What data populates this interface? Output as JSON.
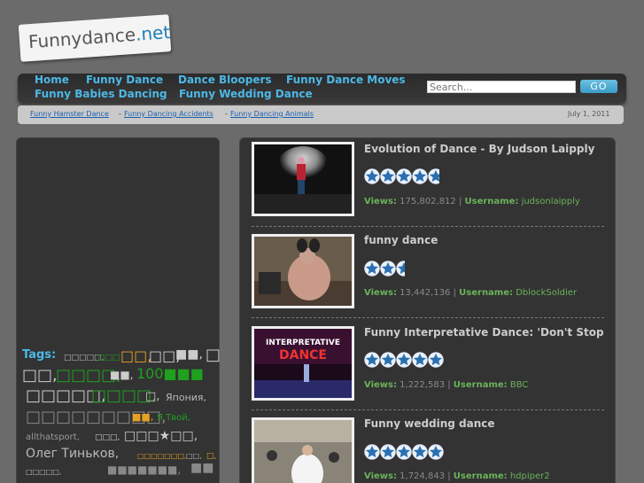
{
  "logo": {
    "name": "Funnydance",
    "tld": ".net"
  },
  "nav": {
    "row1": [
      "Home",
      "Funny Dance",
      "Dance Bloopers",
      "Funny Dance Moves"
    ],
    "row2": [
      "Funny Babies Dancing",
      "Funny Wedding Dance"
    ]
  },
  "search": {
    "placeholder": "Search...",
    "go_label": "GO"
  },
  "breadcrumbs": [
    "Funny Hamster Dance",
    "Funny Dancing Accidents",
    "Funny Dancing Animals"
  ],
  "date": "July 1, 2011",
  "sidebar": {
    "tags_label": "Tags:",
    "tags": [
      "□□□□□,",
      "□□□",
      "□□,",
      "□□,",
      "■■,",
      "□",
      "□□,",
      "□□□□,",
      "■■,",
      "100■■■",
      "□□□□□,",
      "□□□□,",
      "□,",
      "Япония,",
      "□□□□□□□□□,",
      "■■,",
      "Я Твой,",
      "allthatsport,",
      "□□□,",
      "□□□★□□,",
      "Олег Тиньков,",
      "□□□□□□□,",
      "□□,",
      "□,",
      "□□□□□,",
      "■■■■■■■,",
      "■■"
    ]
  },
  "videos": [
    {
      "title": "Evolution of Dance - By Judson Laipply",
      "views_label": "Views:",
      "views": "175,802,812",
      "user_label": "Username:",
      "user": "judsonlaipply",
      "rating": 5
    },
    {
      "title": "funny dance",
      "views_label": "Views:",
      "views": "13,442,136",
      "user_label": "Username:",
      "user": "DblockSoldier",
      "rating": 3
    },
    {
      "title": "Funny Interpretative Dance: 'Don't Stop",
      "views_label": "Views:",
      "views": "1,222,583",
      "user_label": "Username:",
      "user": "BBC",
      "rating": 5
    },
    {
      "title": "Funny wedding dance",
      "views_label": "Views:",
      "views": "1,724,843",
      "user_label": "Username:",
      "user": "hdpiper2",
      "rating": 5
    }
  ],
  "thumb2_text": "INTERPRETATIVE DANCE",
  "colors": {
    "link": "#4cb8e6",
    "green": "#6bb35a",
    "orange": "#e8a020",
    "tag_green": "#1fa01f"
  }
}
